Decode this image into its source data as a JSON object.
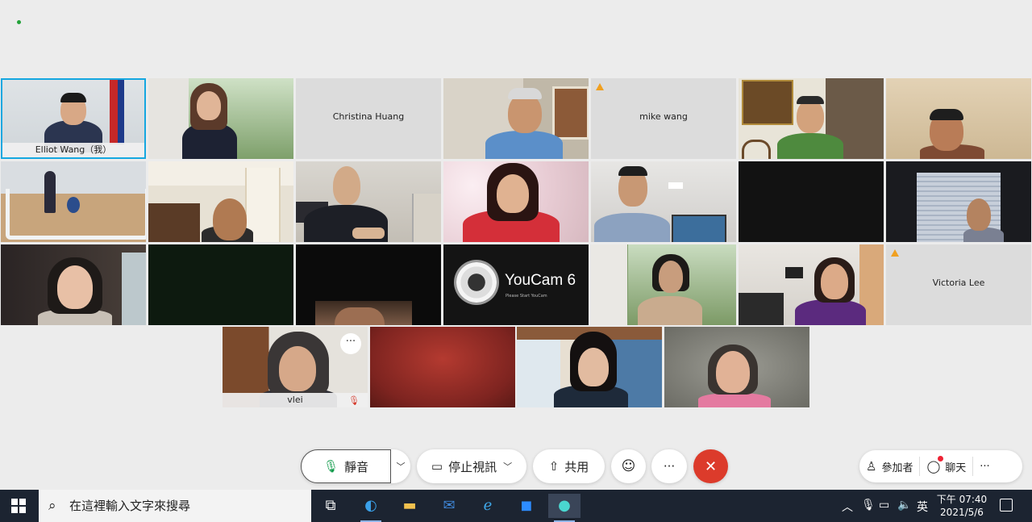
{
  "participants": [
    {
      "name": "Elliot Wang（我）",
      "self": true
    },
    {
      "name": "Christina Huang"
    },
    {
      "name": "mike wang",
      "warning": true
    },
    {
      "name": "Victoria Lee",
      "warning": true
    },
    {
      "name": "vlei",
      "mic_muted": true
    }
  ],
  "youcam": {
    "title": "YouCam 6",
    "subtitle": "Please Start YouCam"
  },
  "toolbar": {
    "mute_label": "靜音",
    "stop_video_label": "停止視訊",
    "share_label": "共用",
    "more_label": "···",
    "participants_label": "參加者",
    "chat_label": "聊天",
    "overflow_label": "···"
  },
  "taskbar": {
    "search_placeholder": "在這裡輸入文字來搜尋",
    "ime_label": "英",
    "time": "下午 07:40",
    "date": "2021/5/6"
  }
}
